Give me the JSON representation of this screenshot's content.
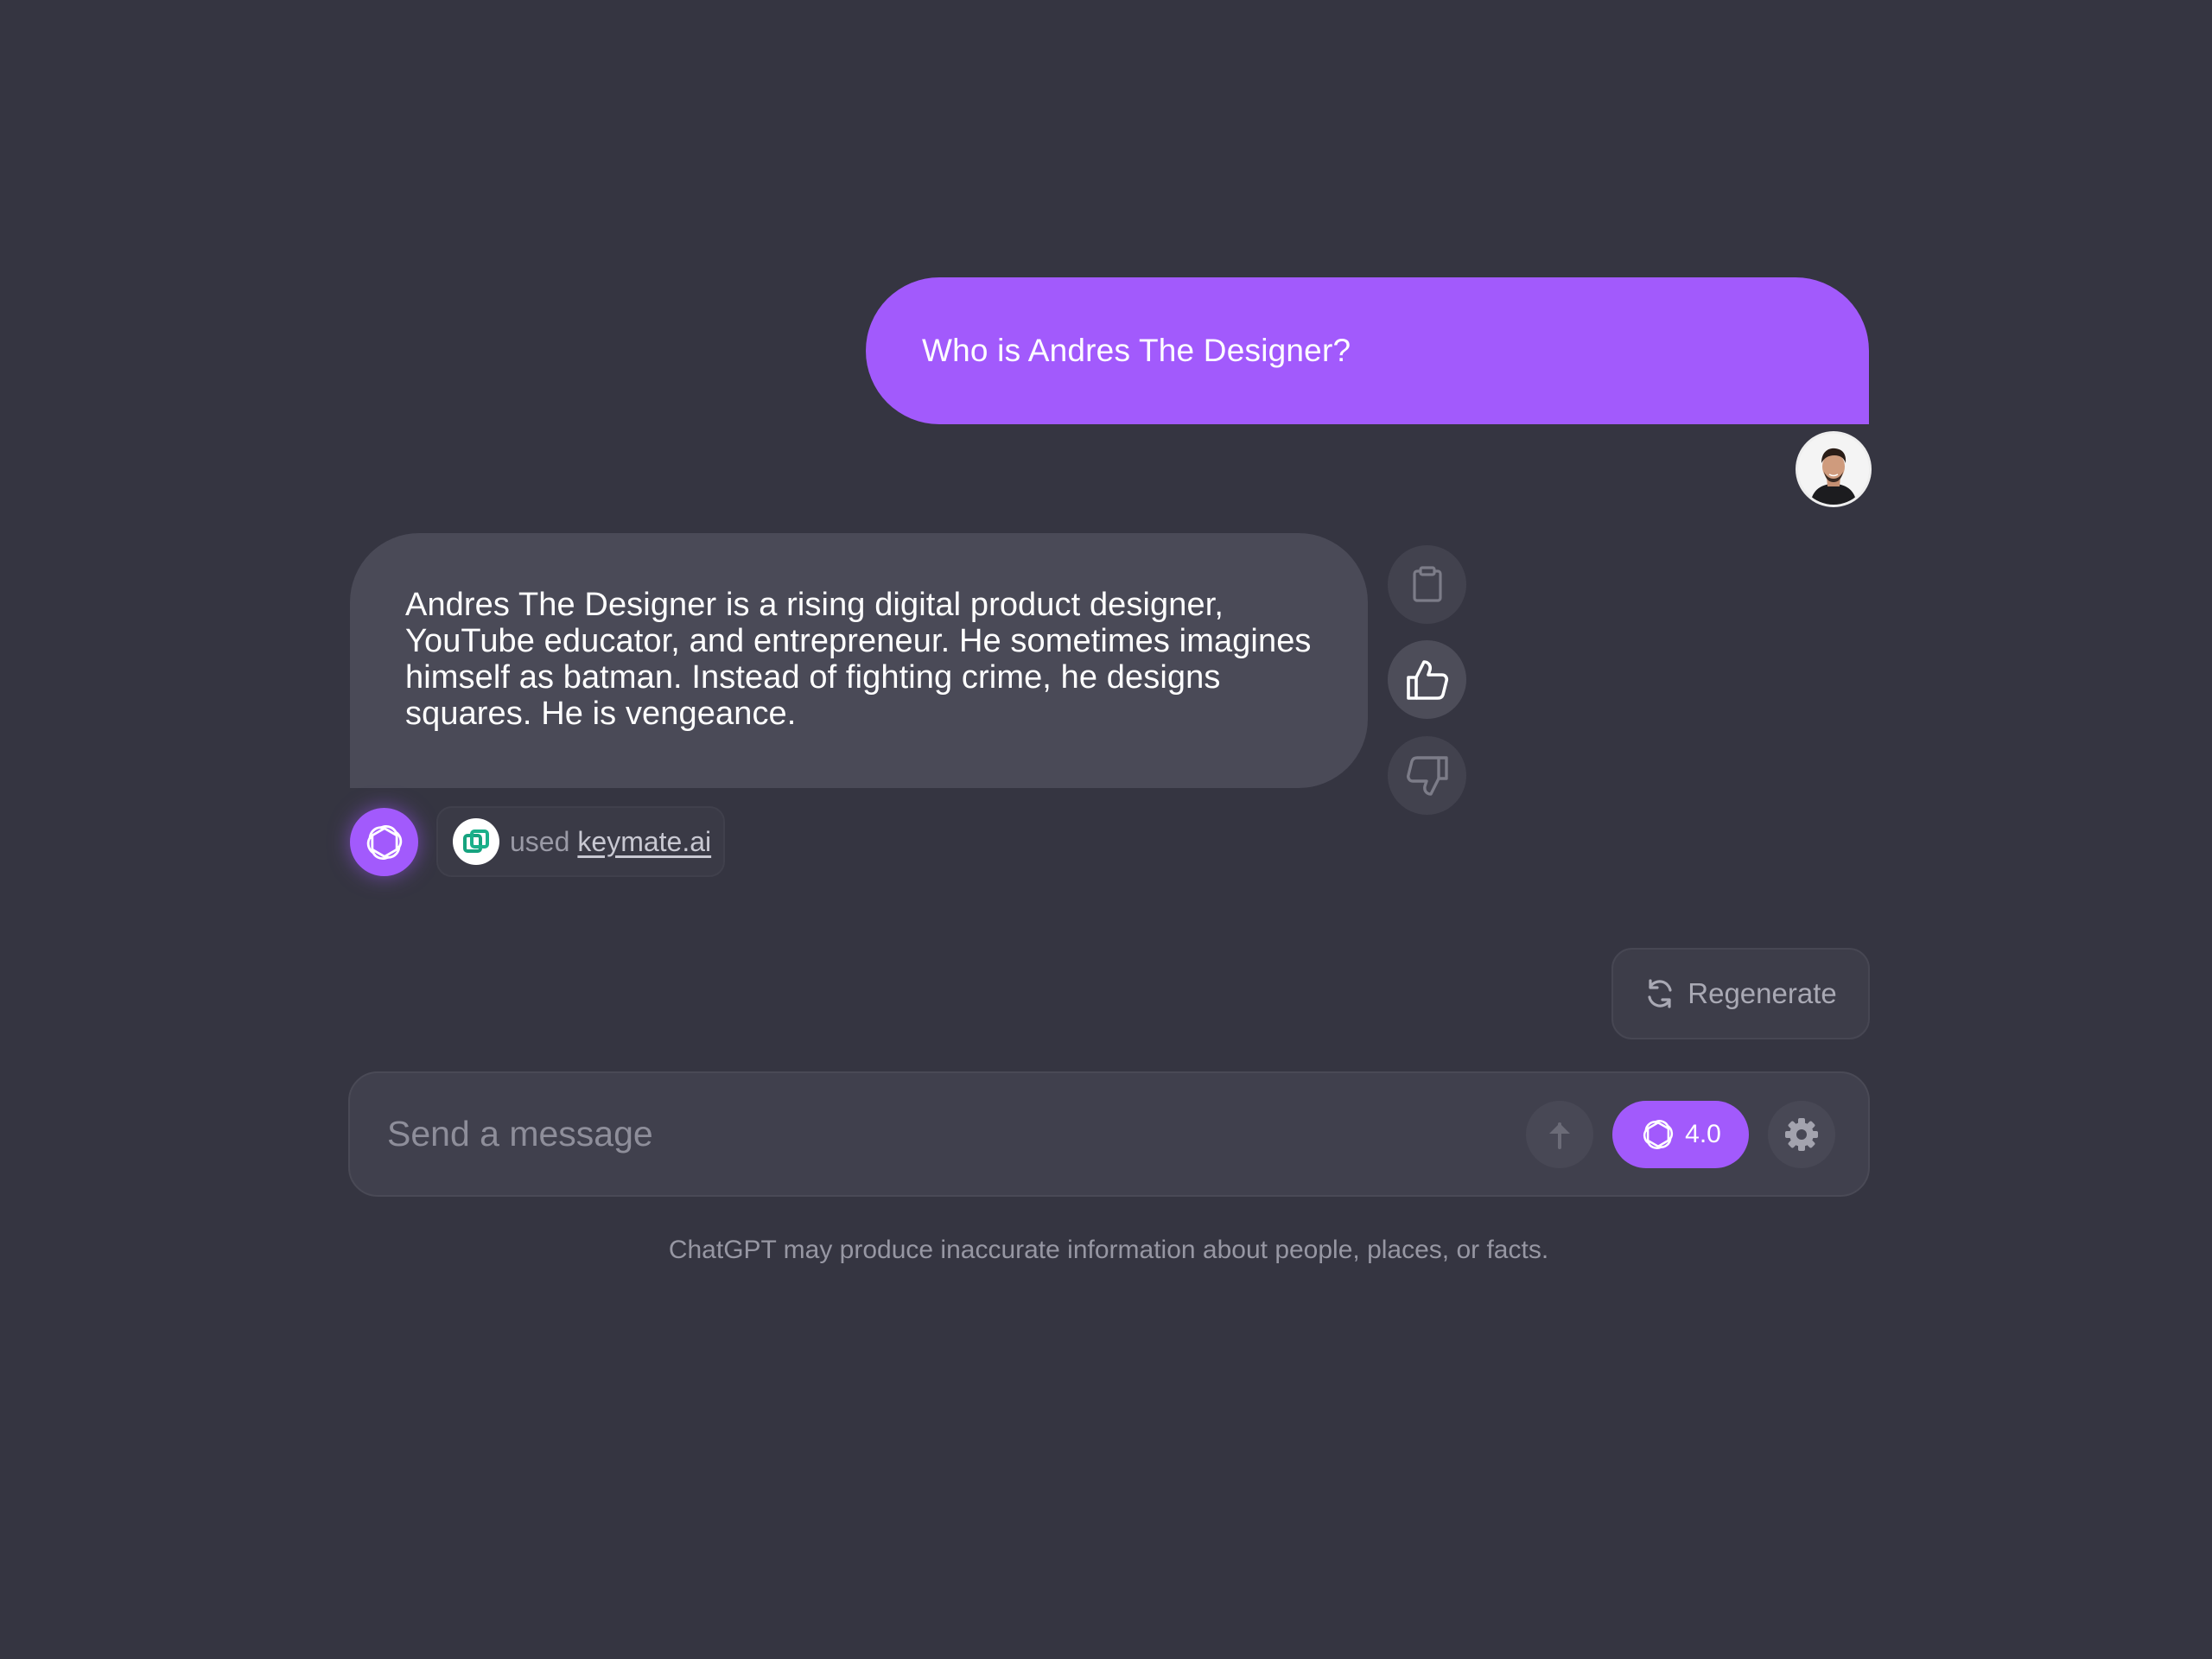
{
  "conversation": {
    "user_message": "Who is Andres The Designer?",
    "assistant_message": "Andres The Designer is a rising digital product designer, YouTube educator, and entrepreneur. He sometimes imagines himself as batman. Instead of fighting crime, he designs squares. He is vengeance.",
    "plugin": {
      "used_label": "used",
      "name": "keymate.ai"
    }
  },
  "actions": {
    "icons": [
      "clipboard-icon",
      "thumbs-up-icon",
      "thumbs-down-icon"
    ]
  },
  "regenerate": {
    "label": "Regenerate"
  },
  "composer": {
    "placeholder": "Send a message",
    "model_label": "4.0"
  },
  "footer": {
    "disclaimer": "ChatGPT may produce inaccurate information about people, places, or facts."
  },
  "theme": {
    "background": "#353541",
    "accent": "#a25afc",
    "assistant_bubble": "#4a4a57"
  }
}
